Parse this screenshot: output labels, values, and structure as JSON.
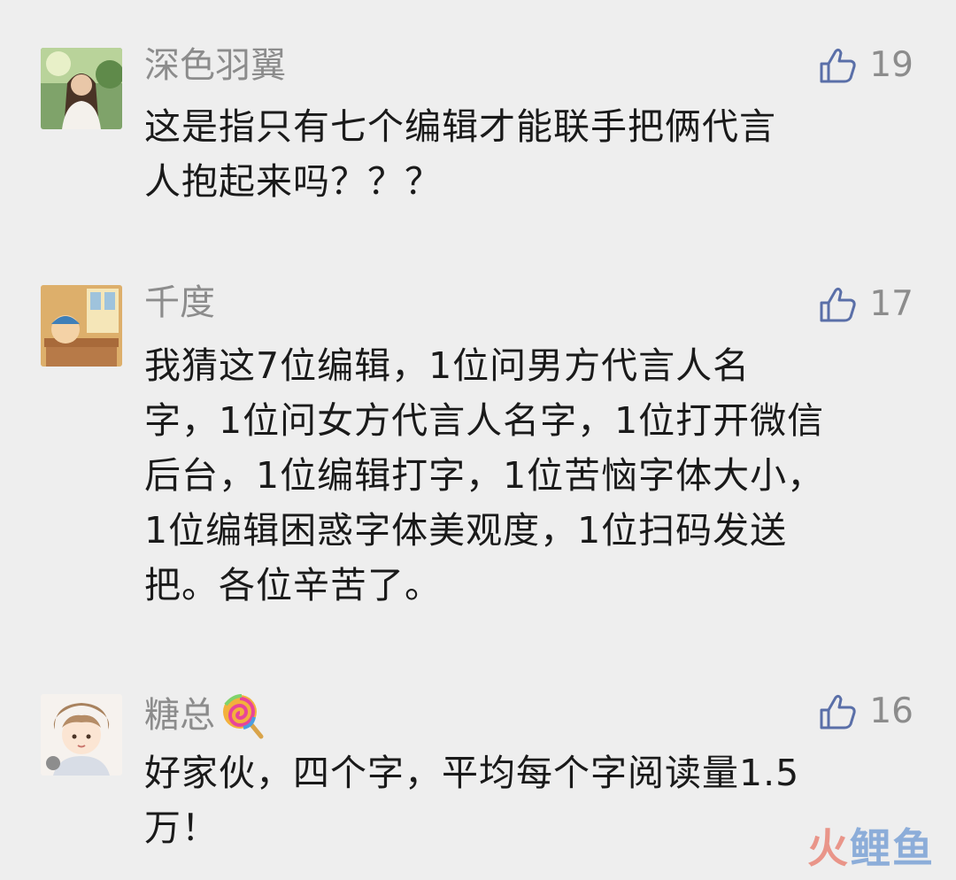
{
  "comments": [
    {
      "nickname": "深色羽翼",
      "likes": "19",
      "text_lines": [
        "这是指只有七个编辑才能联手把俩代言",
        "人抱起来吗？？？"
      ]
    },
    {
      "nickname": "千度",
      "likes": "17",
      "text_lines": [
        "我猜这7位编辑，1位问男方代言人名",
        "字，1位问女方代言人名字，1位打开微信",
        "后台，1位编辑打字，1位苦恼字体大小，",
        "1位编辑困惑字体美观度，1位扫码发送",
        "把。各位辛苦了。"
      ]
    },
    {
      "nickname": "糖总",
      "likes": "16",
      "text_lines": [
        "好家伙，四个字，平均每个字阅读量1.5",
        "万！"
      ]
    }
  ],
  "watermark": {
    "part1": "火",
    "part2": "鲤鱼"
  },
  "colors": {
    "background": "#eeeeee",
    "nickname": "#8c8c8c",
    "text": "#1a1a1a",
    "like_icon": "#5a6fa8"
  },
  "icons": [
    "thumbs-up-icon",
    "lollipop-icon"
  ]
}
